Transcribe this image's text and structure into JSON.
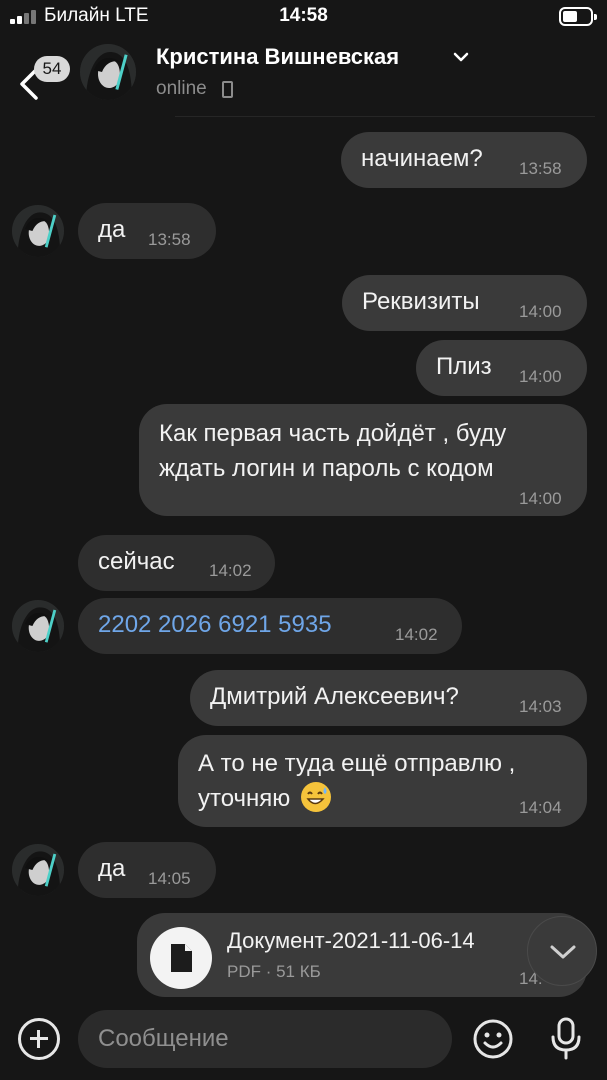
{
  "status_bar": {
    "carrier": "Билайн  LTE",
    "time": "14:58"
  },
  "header": {
    "unread_badge": "54",
    "contact_name": "Кристина Вишневская",
    "presence": "online"
  },
  "messages": [
    {
      "direction": "out",
      "text": "начинаем?",
      "time": "13:58"
    },
    {
      "direction": "in",
      "text": "да",
      "time": "13:58"
    },
    {
      "direction": "out",
      "text": "Реквизиты",
      "time": "14:00"
    },
    {
      "direction": "out",
      "text": "Плиз",
      "time": "14:00"
    },
    {
      "direction": "out",
      "lines": [
        "Как первая часть дойдёт , буду",
        "ждать логин и пароль с кодом"
      ],
      "time": "14:00"
    },
    {
      "direction": "in",
      "text": "сейчас",
      "time": "14:02"
    },
    {
      "direction": "in",
      "text": "2202 2026 6921 5935",
      "time": "14:02",
      "is_link": true
    },
    {
      "direction": "out",
      "text": "Дмитрий Алексеевич?",
      "time": "14:03"
    },
    {
      "direction": "out",
      "lines": [
        "А то не туда ещё отправлю ,",
        "уточняю"
      ],
      "time": "14:04",
      "emoji": "sweat-smile-emoji"
    },
    {
      "direction": "in",
      "text": "да",
      "time": "14:05"
    }
  ],
  "file_message": {
    "name": "Документ-2021-11-06-14",
    "meta": "PDF · 51 КБ",
    "time": "14:"
  },
  "composer": {
    "placeholder": "Сообщение"
  },
  "colors": {
    "background": "#161616",
    "bubble": "#3a3a3a",
    "link": "#6fa6e8",
    "meta_text": "#9a9a9a"
  },
  "icons": [
    "back-chevron-icon",
    "chevron-down-icon",
    "phone-icon",
    "file-icon",
    "scroll-down-icon",
    "plus-icon",
    "smile-icon",
    "microphone-icon"
  ]
}
